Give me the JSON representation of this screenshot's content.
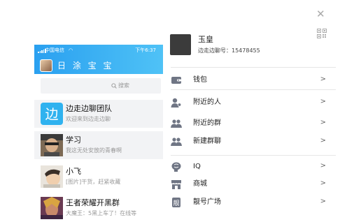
{
  "phone": {
    "status": {
      "carrier": "中国电信",
      "wifi_icon": "wifi-icon",
      "time": "下午6:37"
    },
    "header": {
      "user_name": "日 涂 宝 宝"
    },
    "search": {
      "placeholder": "搜索",
      "icon": "search-icon"
    },
    "chats": [
      {
        "name": "边走边聊团队",
        "message": "欢迎来到边走边聊"
      },
      {
        "name": "学习",
        "message": "我这无处安放的青春啊"
      },
      {
        "name": "小飞",
        "message": "[图片]干货，赶紧收藏"
      },
      {
        "name": "王者荣耀开黑群",
        "message": "大魔王：5黑上车了！在线等"
      }
    ]
  },
  "menu": {
    "profile": {
      "name": "玉皇",
      "account": "边走边聊号：15478455"
    },
    "close_icon": "close-icon",
    "qr_icon": "qr-code-icon",
    "arrow": ">",
    "items": [
      {
        "label": "钱包",
        "icon": "wallet-icon"
      },
      {
        "label": "附近的人",
        "icon": "person-location-icon"
      },
      {
        "label": "附近的群",
        "icon": "group-icon"
      },
      {
        "label": "新建群聊",
        "icon": "group-add-icon"
      },
      {
        "label": "IQ",
        "icon": "brain-icon"
      },
      {
        "label": "商城",
        "icon": "shop-icon"
      },
      {
        "label": "靓号广场",
        "icon": "number-tag-icon"
      }
    ]
  },
  "colors": {
    "header_start": "#2aa0f0",
    "header_end": "#4fc2f6",
    "team_icon": "#2fb2ef",
    "menu_icon": "#6f7584"
  }
}
